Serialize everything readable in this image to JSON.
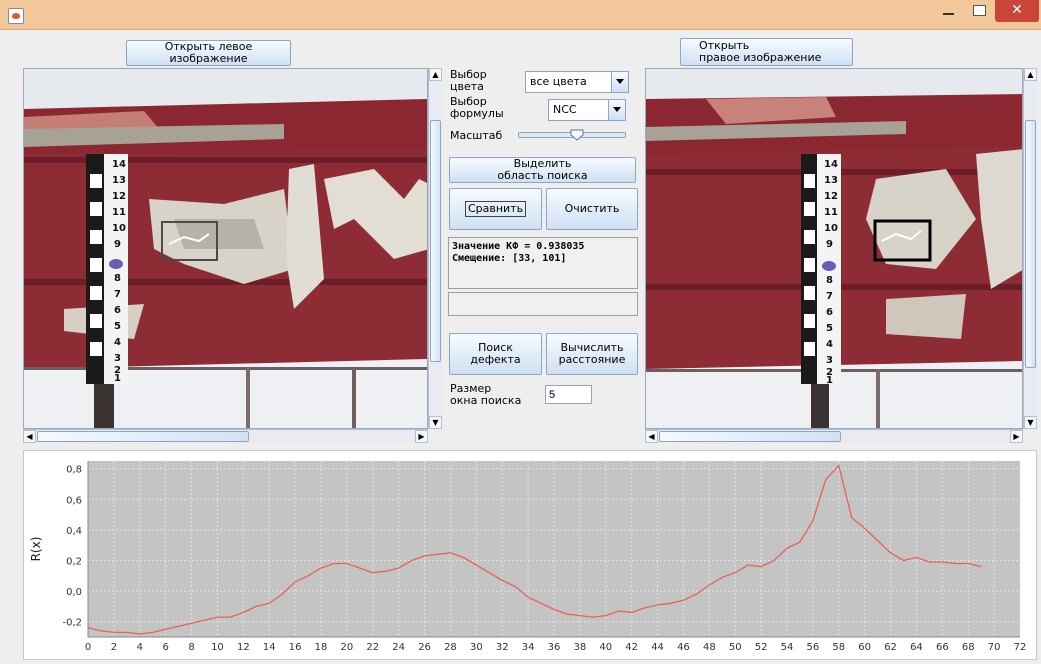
{
  "window": {
    "close_glyph": "✕"
  },
  "left_panel": {
    "open_label": "Открыть левое\nизображение"
  },
  "right_panel": {
    "open_label": "Открыть\nправое изображение"
  },
  "controls": {
    "color_label": "Выбор\nцвета",
    "color_value": "все цвета",
    "formula_label": "Выбор\nформулы",
    "formula_value": "NCC",
    "scale_label": "Масштаб",
    "scale_level": 0.55,
    "select_area_label": "Выделить\nобласть поиска",
    "compare_label": "Сравнить",
    "clear_label": "Очистить",
    "result_text": "Значение КФ = 0.938035\nСмещение: [33, 101]",
    "defect_label": "Поиск\nдефекта",
    "distance_label": "Вычислить\nрасстояние",
    "window_size_label": "Размер\nокна поиска",
    "window_size_value": "5"
  },
  "ruler_numbers": [
    "14",
    "13",
    "12",
    "11",
    "10",
    "9",
    "8",
    "7",
    "6",
    "5",
    "4",
    "3",
    "2",
    "1"
  ],
  "colors": {
    "pipe_red": "#8e2c35",
    "line": "#e8605a",
    "plot_bg": "#c4c4c4"
  },
  "chart_data": {
    "type": "line",
    "ylabel": "R(x)",
    "x_ticks": [
      0,
      2,
      4,
      6,
      8,
      10,
      12,
      14,
      16,
      18,
      20,
      22,
      24,
      26,
      28,
      30,
      32,
      34,
      36,
      38,
      40,
      42,
      44,
      46,
      48,
      50,
      52,
      54,
      56,
      58,
      60,
      62,
      64,
      66,
      68,
      70,
      72
    ],
    "y_ticks": [
      "-0,2",
      "0,0",
      "0,2",
      "0,4",
      "0,6",
      "0,8"
    ],
    "y_tick_values": [
      -0.2,
      0,
      0.2,
      0.4,
      0.6,
      0.8
    ],
    "xlim": [
      0,
      72
    ],
    "ylim": [
      -0.3,
      0.85
    ],
    "grid": true,
    "x": [
      0,
      1,
      2,
      3,
      4,
      5,
      6,
      7,
      8,
      9,
      10,
      11,
      12,
      13,
      14,
      15,
      16,
      17,
      18,
      19,
      20,
      21,
      22,
      23,
      24,
      25,
      26,
      27,
      28,
      29,
      30,
      31,
      32,
      33,
      34,
      35,
      36,
      37,
      38,
      39,
      40,
      41,
      42,
      43,
      44,
      45,
      46,
      47,
      48,
      49,
      50,
      51,
      52,
      53,
      54,
      55,
      56,
      57,
      58,
      59,
      60,
      61,
      62,
      63,
      64,
      65,
      66,
      67,
      68,
      69
    ],
    "y": [
      -0.24,
      -0.26,
      -0.27,
      -0.27,
      -0.28,
      -0.27,
      -0.25,
      -0.23,
      -0.21,
      -0.19,
      -0.17,
      -0.17,
      -0.14,
      -0.1,
      -0.08,
      -0.02,
      0.06,
      0.1,
      0.15,
      0.18,
      0.18,
      0.15,
      0.12,
      0.13,
      0.15,
      0.2,
      0.23,
      0.24,
      0.25,
      0.22,
      0.17,
      0.12,
      0.07,
      0.03,
      -0.04,
      -0.08,
      -0.12,
      -0.15,
      -0.16,
      -0.17,
      -0.16,
      -0.13,
      -0.14,
      -0.11,
      -0.09,
      -0.08,
      -0.06,
      -0.02,
      0.04,
      0.09,
      0.12,
      0.17,
      0.16,
      0.2,
      0.28,
      0.32,
      0.46,
      0.73,
      0.82,
      0.48,
      0.41,
      0.33,
      0.25,
      0.2,
      0.22,
      0.19,
      0.19,
      0.18,
      0.18,
      0.16
    ]
  }
}
